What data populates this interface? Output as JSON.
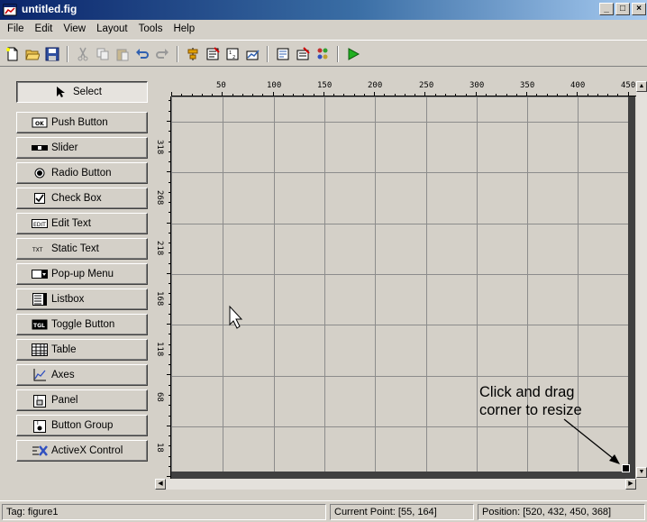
{
  "window": {
    "title": "untitled.fig",
    "minimize": "_",
    "maximize": "□",
    "close": "×"
  },
  "menu": [
    "File",
    "Edit",
    "View",
    "Layout",
    "Tools",
    "Help"
  ],
  "toolbar": [
    "new-file-icon",
    "open-folder-icon",
    "save-icon",
    "cut-icon",
    "copy-icon",
    "paste-icon",
    "undo-icon",
    "redo-icon",
    "align-objects-icon",
    "menu-editor-icon",
    "tab-order-editor-icon",
    "toolbar-editor-icon",
    "mfile-editor-icon",
    "property-inspector-icon",
    "object-browser-icon",
    "run-icon"
  ],
  "palette": [
    {
      "label": "Select",
      "icon": "arrow-cursor-icon",
      "selected": true
    },
    {
      "label": "Push Button",
      "icon": "push-button-icon"
    },
    {
      "label": "Slider",
      "icon": "slider-icon"
    },
    {
      "label": "Radio Button",
      "icon": "radio-button-icon"
    },
    {
      "label": "Check Box",
      "icon": "check-box-icon"
    },
    {
      "label": "Edit Text",
      "icon": "edit-text-icon"
    },
    {
      "label": "Static Text",
      "icon": "static-text-icon"
    },
    {
      "label": "Pop-up Menu",
      "icon": "popup-menu-icon"
    },
    {
      "label": "Listbox",
      "icon": "listbox-icon"
    },
    {
      "label": "Toggle Button",
      "icon": "toggle-button-icon"
    },
    {
      "label": "Table",
      "icon": "table-icon"
    },
    {
      "label": "Axes",
      "icon": "axes-icon"
    },
    {
      "label": "Panel",
      "icon": "panel-icon"
    },
    {
      "label": "Button Group",
      "icon": "button-group-icon"
    },
    {
      "label": "ActiveX Control",
      "icon": "activex-icon"
    }
  ],
  "ruler": {
    "top_labels": [
      "50",
      "100",
      "150",
      "200",
      "250",
      "300",
      "350",
      "400",
      "450"
    ],
    "left_labels": [
      "318",
      "268",
      "218",
      "168",
      "118",
      "68",
      "18"
    ]
  },
  "annotation": {
    "line1": "Click and drag",
    "line2": "corner to resize"
  },
  "status": {
    "tag": "Tag: figure1",
    "current_point": "Current Point:  [55, 164]",
    "position": "Position: [520, 432, 450, 368]"
  }
}
